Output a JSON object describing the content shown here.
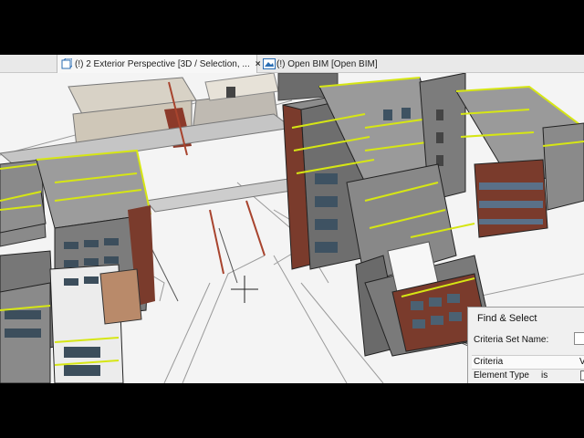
{
  "tabs": [
    {
      "label": "(!) 2 Exterior Perspective [3D / Selection, ...",
      "close": "×",
      "icon": "3d-window-icon",
      "active": true
    },
    {
      "label": "(!) Open BIM [Open BIM]",
      "icon": "layout-sheet-icon",
      "active": false
    }
  ],
  "find_select": {
    "title": "Find & Select",
    "criteria_set_label": "Criteria Set Name:",
    "col_criteria": "Criteria",
    "col_value": "V",
    "row_element": "Element Type",
    "row_operator": "is"
  },
  "colors": {
    "accent_yellow": "#d6e614",
    "brick": "#7a3b2c",
    "concrete": "#8c8c8c",
    "glass": "#5b7890"
  }
}
